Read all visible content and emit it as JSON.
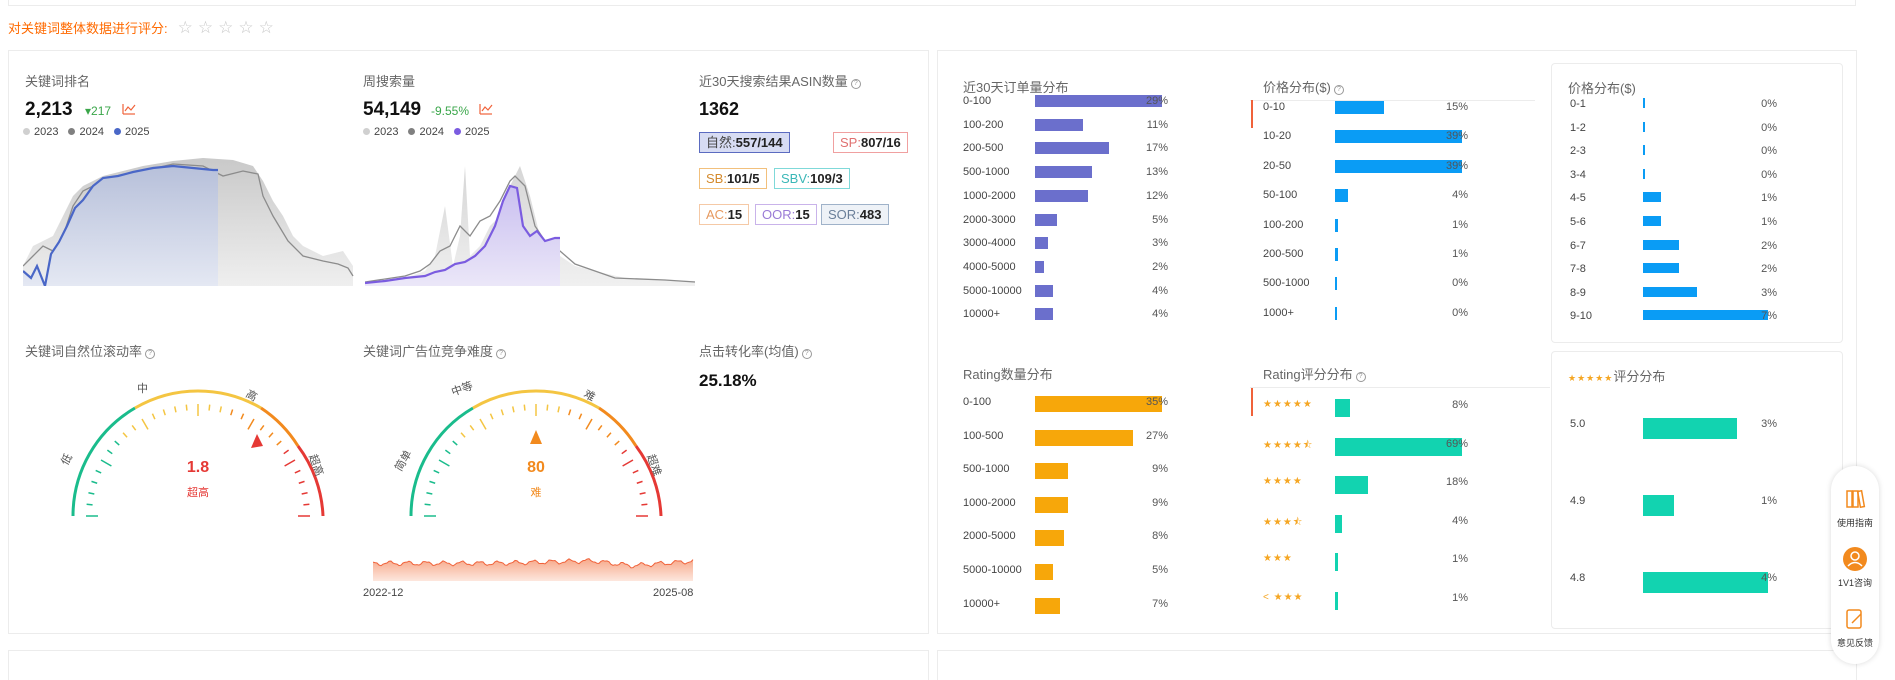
{
  "rating_prompt": "对关键词整体数据进行评分:",
  "rating_stars": [
    "☆",
    "☆",
    "☆",
    "☆",
    "☆"
  ],
  "keyword_rank": {
    "title": "关键词排名",
    "value": "2,213",
    "delta": "217",
    "legend": [
      {
        "name": "2023",
        "color": "#d0d0d0"
      },
      {
        "name": "2024",
        "color": "#808080"
      },
      {
        "name": "2025",
        "color": "#4a67c7"
      }
    ]
  },
  "weekly_search": {
    "title": "周搜索量",
    "value": "54,149",
    "delta": "-9.55%",
    "legend": [
      {
        "name": "2023",
        "color": "#d0d0d0"
      },
      {
        "name": "2024",
        "color": "#808080"
      },
      {
        "name": "2025",
        "color": "#7b5ce0"
      }
    ]
  },
  "asin_count": {
    "title": "近30天搜索结果ASIN数量",
    "value": "1362",
    "tags": [
      {
        "label": "自然:",
        "value": "557/144",
        "color": "#5b6bc0",
        "bg": "#d7dcf3"
      },
      {
        "label": "SP:",
        "value": "807/16",
        "color": "#f08c8c",
        "bg": "#fff"
      },
      {
        "label": "SB:",
        "value": "101/5",
        "color": "#f2b45c",
        "bg": "#fff"
      },
      {
        "label": "SBV:",
        "value": "109/3",
        "color": "#5fcfcf",
        "bg": "#fff"
      },
      {
        "label": "AC:",
        "value": "15",
        "color": "#f5c9a6",
        "bg": "#fff"
      },
      {
        "label": "OOR:",
        "value": "15",
        "color": "#c9b3ea",
        "bg": "#fff"
      },
      {
        "label": "SOR:",
        "value": "483",
        "color": "#9fb2c9",
        "bg": "#eef2f7"
      }
    ]
  },
  "natural_roll": {
    "title": "关键词自然位滚动率",
    "gauge_labels": [
      "低",
      "中",
      "高",
      "超高"
    ],
    "value": 1.8,
    "value_text": "1.8",
    "level_text": "超高"
  },
  "ad_difficulty": {
    "title": "关键词广告位竞争难度",
    "gauge_labels": [
      "简单",
      "中等",
      "难",
      "超难"
    ],
    "value": 80,
    "value_text": "80",
    "level_text": "难",
    "x_start": "2022-12",
    "x_end": "2025-08"
  },
  "ctr": {
    "title": "点击转化率(均值)",
    "value": "25.18%"
  },
  "order_dist": {
    "title": "近30天订单量分布",
    "color": "#6b6fcc",
    "rows": [
      {
        "label": "0-100",
        "pct": 29,
        "text": "29%"
      },
      {
        "label": "100-200",
        "pct": 11,
        "text": "11%"
      },
      {
        "label": "200-500",
        "pct": 17,
        "text": "17%"
      },
      {
        "label": "500-1000",
        "pct": 13,
        "text": "13%"
      },
      {
        "label": "1000-2000",
        "pct": 12,
        "text": "12%"
      },
      {
        "label": "2000-3000",
        "pct": 5,
        "text": "5%"
      },
      {
        "label": "3000-4000",
        "pct": 3,
        "text": "3%"
      },
      {
        "label": "4000-5000",
        "pct": 2,
        "text": "2%"
      },
      {
        "label": "5000-10000",
        "pct": 4,
        "text": "4%"
      },
      {
        "label": "10000+",
        "pct": 4,
        "text": "4%"
      }
    ]
  },
  "price_dist": {
    "title": "价格分布($)",
    "color": "#0a9cf5",
    "rows": [
      {
        "label": "0-10",
        "pct": 15,
        "text": "15%"
      },
      {
        "label": "10-20",
        "pct": 39,
        "text": "39%"
      },
      {
        "label": "20-50",
        "pct": 39,
        "text": "39%"
      },
      {
        "label": "50-100",
        "pct": 4,
        "text": "4%"
      },
      {
        "label": "100-200",
        "pct": 1,
        "text": "1%"
      },
      {
        "label": "200-500",
        "pct": 1,
        "text": "1%"
      },
      {
        "label": "500-1000",
        "pct": 0,
        "text": "0%"
      },
      {
        "label": "1000+",
        "pct": 0,
        "text": "0%"
      }
    ]
  },
  "price_dist_fine": {
    "title": "价格分布($)",
    "color": "#0a9cf5",
    "rows": [
      {
        "label": "0-1",
        "pct": 0,
        "text": "0%"
      },
      {
        "label": "1-2",
        "pct": 0,
        "text": "0%"
      },
      {
        "label": "2-3",
        "pct": 0,
        "text": "0%"
      },
      {
        "label": "3-4",
        "pct": 0,
        "text": "0%"
      },
      {
        "label": "4-5",
        "pct": 1,
        "text": "1%"
      },
      {
        "label": "5-6",
        "pct": 1,
        "text": "1%"
      },
      {
        "label": "6-7",
        "pct": 2,
        "text": "2%"
      },
      {
        "label": "7-8",
        "pct": 2,
        "text": "2%"
      },
      {
        "label": "8-9",
        "pct": 3,
        "text": "3%"
      },
      {
        "label": "9-10",
        "pct": 7,
        "text": "7%"
      }
    ]
  },
  "rating_count_dist": {
    "title": "Rating数量分布",
    "color": "#f7a70a",
    "rows": [
      {
        "label": "0-100",
        "pct": 35,
        "text": "35%"
      },
      {
        "label": "100-500",
        "pct": 27,
        "text": "27%"
      },
      {
        "label": "500-1000",
        "pct": 9,
        "text": "9%"
      },
      {
        "label": "1000-2000",
        "pct": 9,
        "text": "9%"
      },
      {
        "label": "2000-5000",
        "pct": 8,
        "text": "8%"
      },
      {
        "label": "5000-10000",
        "pct": 5,
        "text": "5%"
      },
      {
        "label": "10000+",
        "pct": 7,
        "text": "7%"
      }
    ]
  },
  "rating_score_dist": {
    "title": "Rating评分分布",
    "color": "#12d3b0",
    "rows": [
      {
        "label": "★★★★★",
        "pct": 8,
        "text": "8%"
      },
      {
        "label": "★★★★⯪",
        "pct": 69,
        "text": "69%"
      },
      {
        "label": "★★★★",
        "pct": 18,
        "text": "18%"
      },
      {
        "label": "★★★⯪",
        "pct": 4,
        "text": "4%"
      },
      {
        "label": "★★★",
        "pct": 1,
        "text": "1%"
      },
      {
        "label": "< ★★★",
        "pct": 1,
        "text": "1%"
      }
    ]
  },
  "five_star_dist": {
    "stars": "★★★★★",
    "title": "评分分布",
    "color": "#12d3b0",
    "rows": [
      {
        "label": "5.0",
        "pct": 3,
        "text": "3%"
      },
      {
        "label": "4.9",
        "pct": 1,
        "text": "1%"
      },
      {
        "label": "4.8",
        "pct": 4,
        "text": "4%"
      }
    ]
  },
  "sidebar": {
    "guide": "使用指南",
    "consult": "1V1咨询",
    "feedback": "意见反馈"
  }
}
